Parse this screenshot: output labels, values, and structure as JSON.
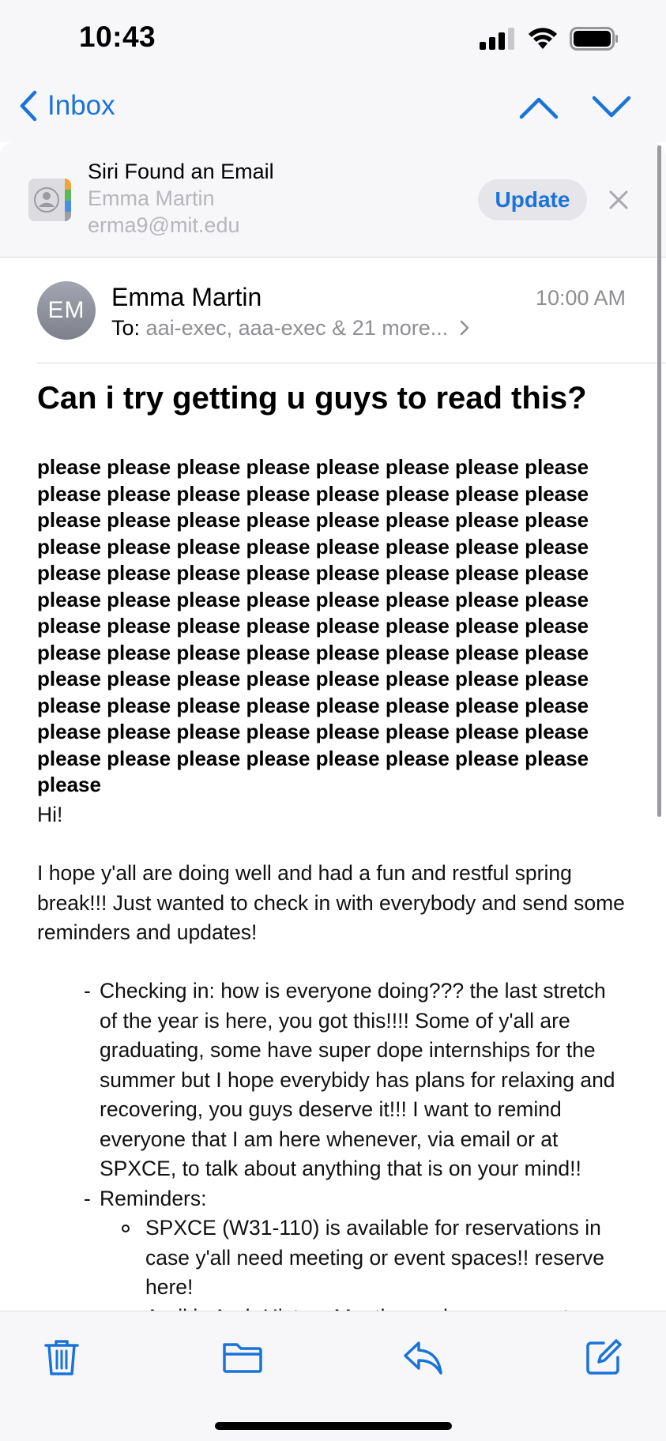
{
  "status_bar": {
    "time": "10:43"
  },
  "nav": {
    "back_label": "Inbox"
  },
  "siri_banner": {
    "title": "Siri Found an Email",
    "name": "Emma Martin",
    "email": "erma9@mit.edu",
    "update_label": "Update"
  },
  "message": {
    "avatar_initials": "EM",
    "sender": "Emma Martin",
    "to_label": "To:",
    "recipients": "aai-exec, aaa-exec & 21 more...",
    "time": "10:00 AM",
    "subject": "Can i try getting u guys to read this?",
    "please_block": "please please please please please please please please please please please please please please please please please please please please please please please please please please please please please please please please please please please please please please please please please please please please please please please please please please please please please please please please please please please please please please please please please please please please please please please please please please please please please please please please please please please please please please please please please please please please please please please please please",
    "greeting": "Hi!",
    "paragraph1": "I hope y'all are doing well and had a fun and restful spring break!!! Just wanted to check in with everybody and send some reminders and updates!",
    "bullet_checkin": "Checking in: how is everyone doing??? the last stretch of the year is here, you got this!!!! Some of y'all are graduating, some have super dope internships for the summer but I hope everybidy has plans for relaxing and recovering, you guys deserve it!!! I want to remind everyone that I am here whenever, via email or at SPXCE, to talk about anything that is on your mind!!",
    "bullet_reminders": "Reminders:",
    "sub_bullet_spxce": "SPXCE (W31-110) is available for reservations in case y'all need meeting or event spaces!! reserve here!",
    "sub_bullet_partial": "April is Arab History Month, so please support"
  },
  "toolbar": {
    "icons": [
      "trash-icon",
      "folder-icon",
      "reply-icon",
      "compose-icon"
    ]
  },
  "colors": {
    "accent": "#1a73d9",
    "secondary_text": "#8e8e93",
    "bar_background": "#f7f7f9"
  }
}
